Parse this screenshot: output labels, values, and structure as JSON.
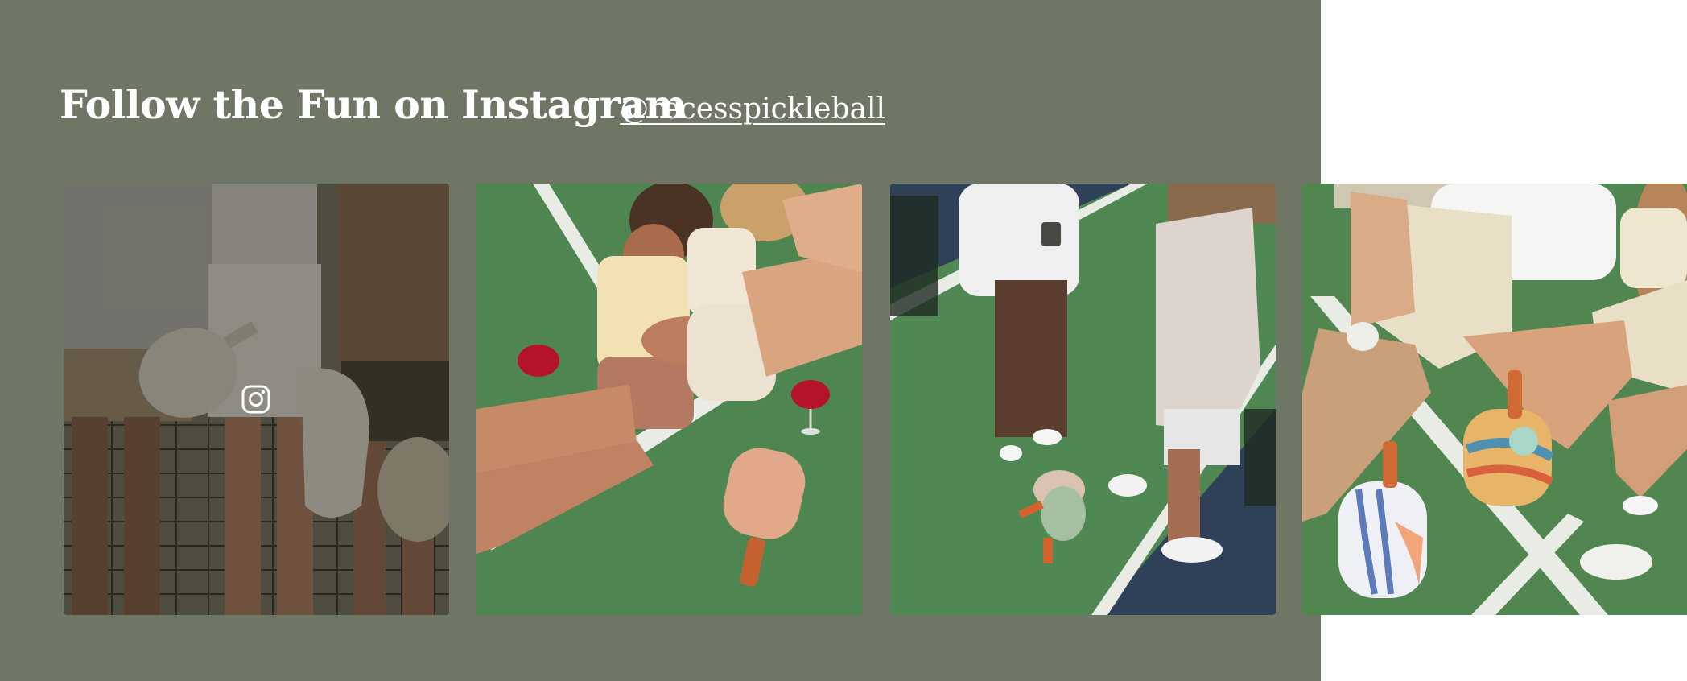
{
  "section": {
    "title": "Follow the Fun on Instagram",
    "handle": "@recesspickleball",
    "background_color": "#6f7665"
  },
  "posts": [
    {
      "icon": "instagram-icon",
      "hovered": true
    },
    {
      "hovered": false
    },
    {
      "hovered": false
    },
    {
      "hovered": false
    }
  ]
}
